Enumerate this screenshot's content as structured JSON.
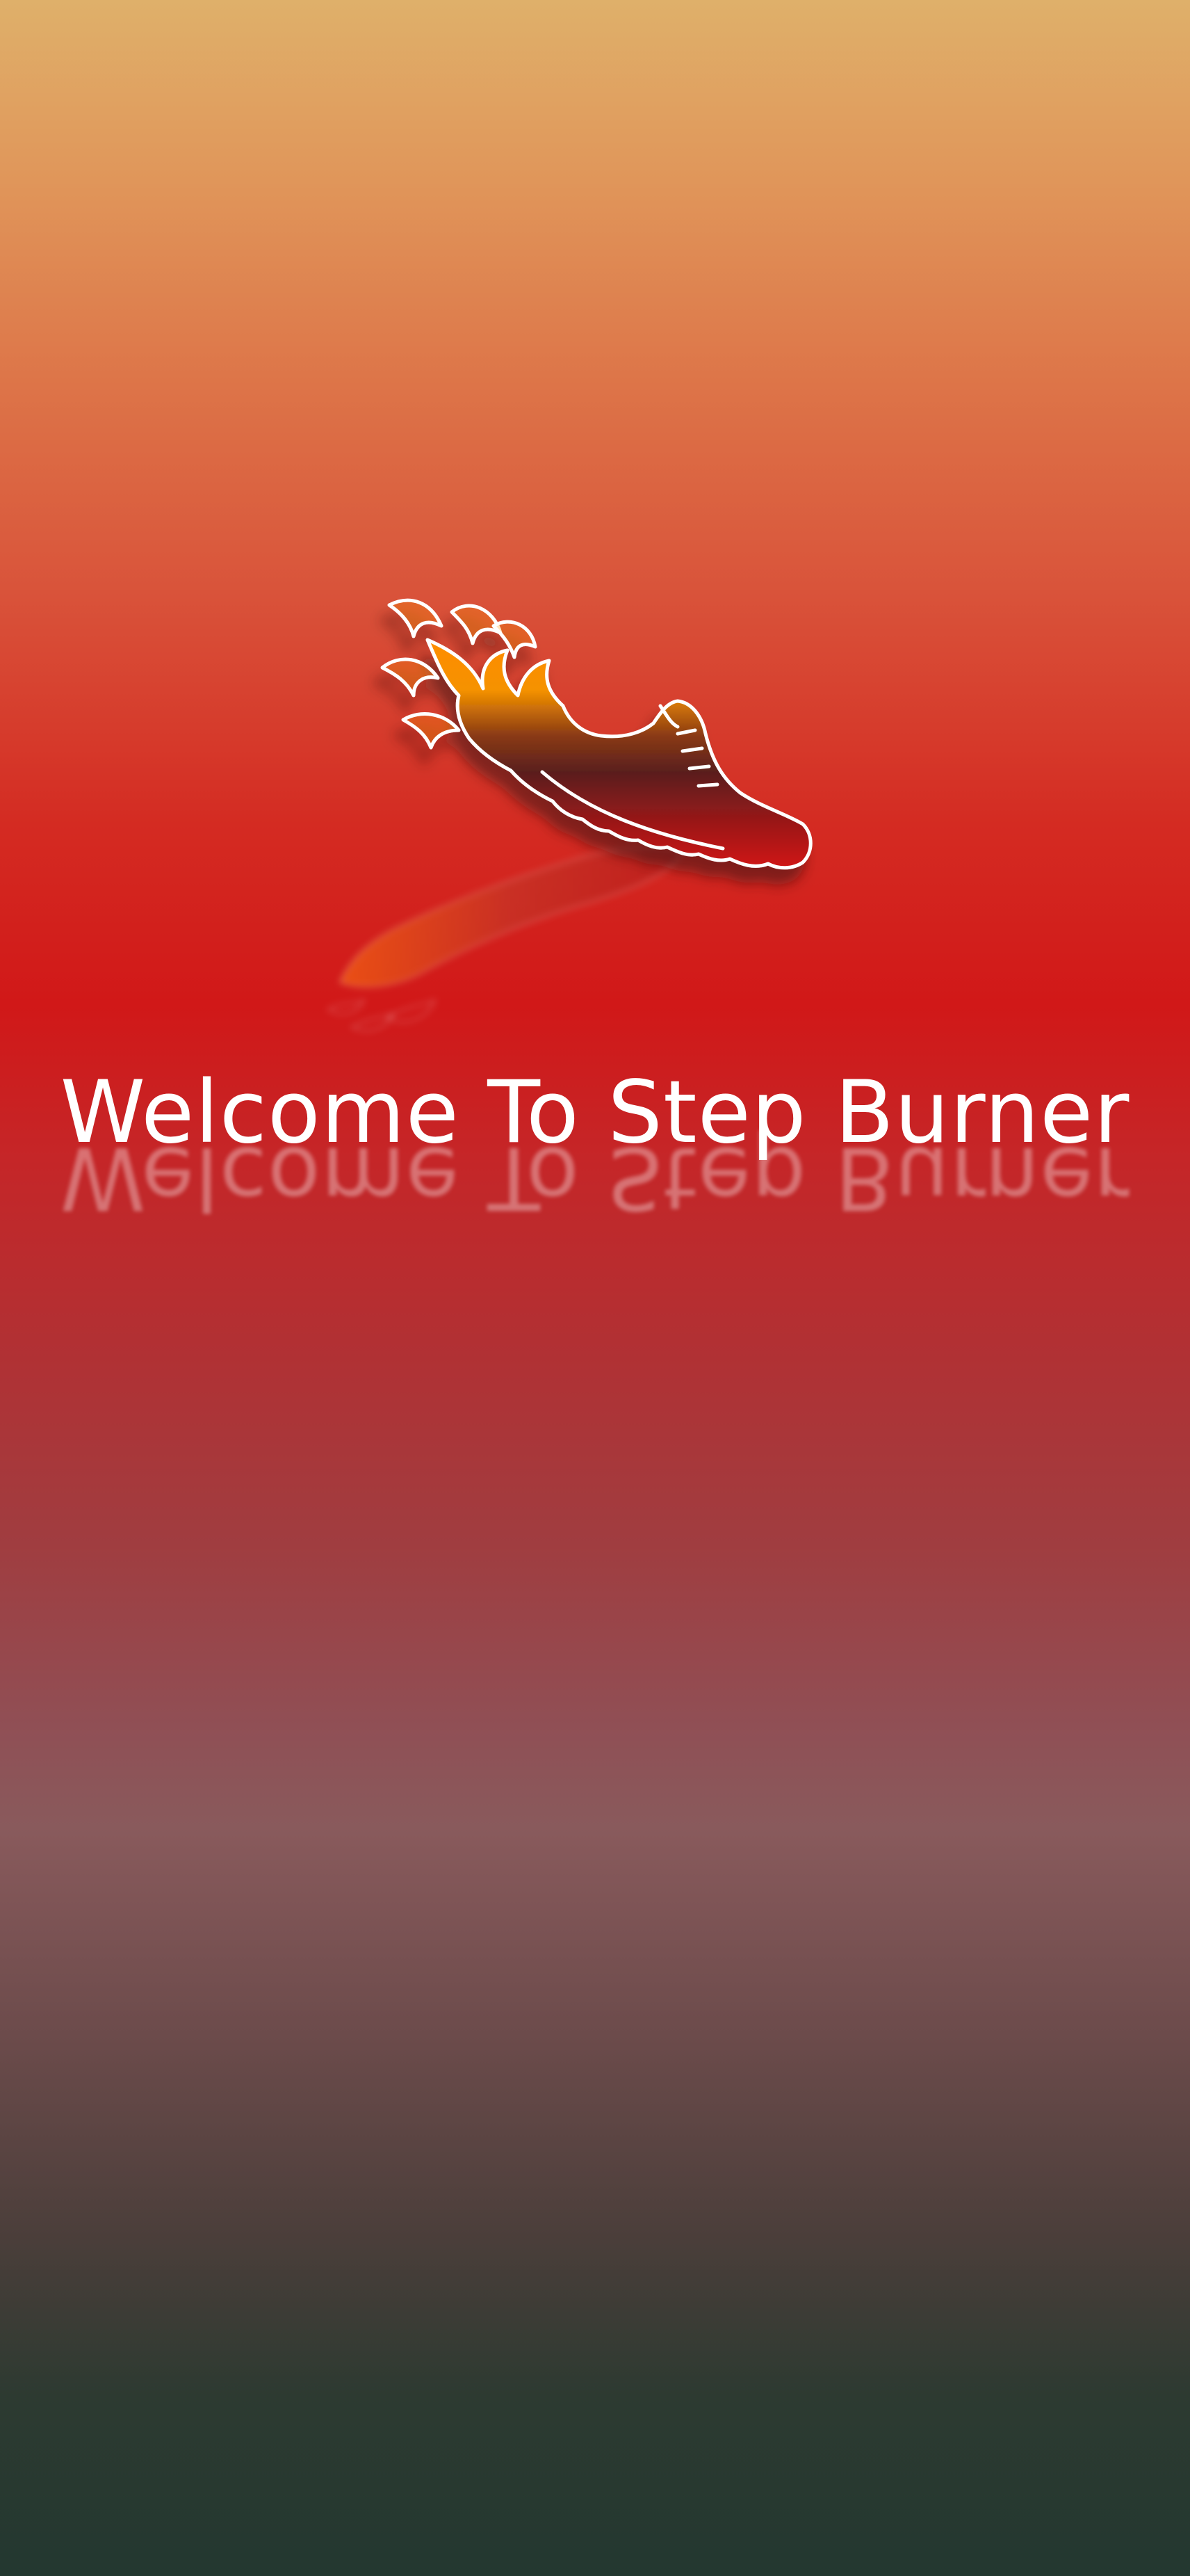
{
  "app": {
    "name": "Step Burner",
    "icon": "flaming-shoe-icon"
  },
  "splash": {
    "welcome_text": "Welcome To Step Burner",
    "welcome_reflection_text": "Welcome To Step Burner"
  },
  "colors": {
    "background_top": "#dfb06a",
    "background_mid_red": "#d11818",
    "background_mauve": "#895a5c",
    "background_bottom": "#233830",
    "text": "#ffffff",
    "flame_orange": "#ff9a00",
    "shoe_dark": "#5a1f1f",
    "shoe_red": "#c61a1a"
  }
}
